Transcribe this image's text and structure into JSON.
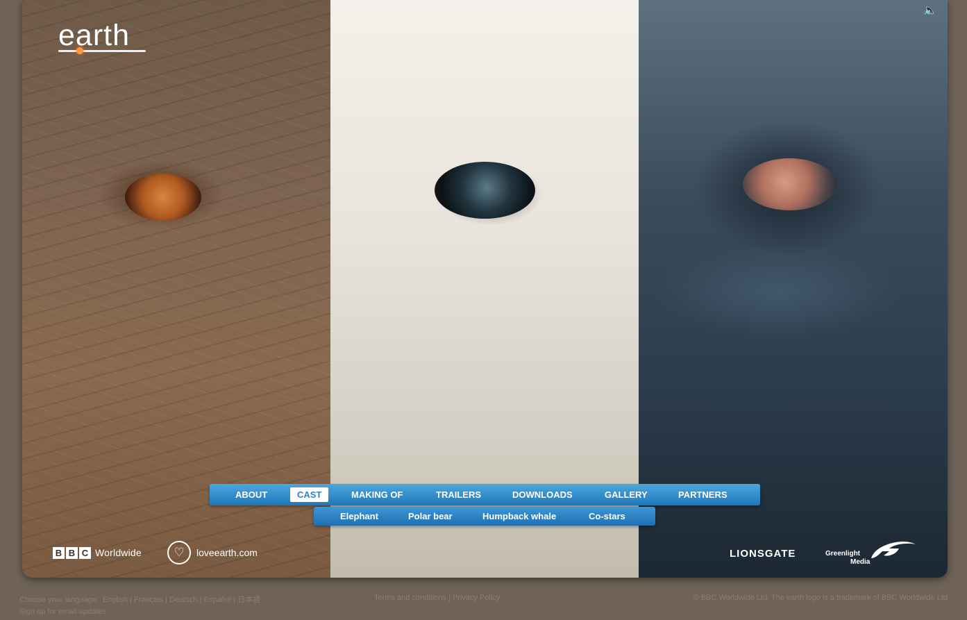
{
  "logo": {
    "text": "earth"
  },
  "sound_icon": "speaker-icon",
  "nav": {
    "main": [
      "ABOUT",
      "CAST",
      "MAKING OF",
      "TRAILERS",
      "DOWNLOADS",
      "GALLERY",
      "PARTNERS"
    ],
    "active": "CAST",
    "sub": [
      "Elephant",
      "Polar bear",
      "Humpback whale",
      "Co-stars"
    ]
  },
  "panels": [
    "elephant",
    "polar-bear",
    "humpback-whale"
  ],
  "bottom_logos": {
    "bbc_letters": [
      "B",
      "B",
      "C"
    ],
    "bbc_worldwide": "Worldwide",
    "loveearth": "loveearth.com",
    "lionsgate": "LIONSGATE",
    "greenlight_line1": "Greenlight",
    "greenlight_line2": "Media"
  },
  "footer": {
    "language_label": "Choose your language:",
    "languages": [
      "English |",
      "Français |",
      "Deutsch |",
      "Español |",
      "日本語"
    ],
    "signup": "Sign up for email updates",
    "terms": "Terms and conditions",
    "separator": "|",
    "privacy": "Privacy Policy",
    "copyright": "© BBC Worldwide Ltd. The earth logo is a trademark of BBC Worldwide Ltd"
  },
  "colors": {
    "nav_blue": "#1d78bb",
    "background": "#6f6358",
    "footer_text": "#8a7d70"
  }
}
